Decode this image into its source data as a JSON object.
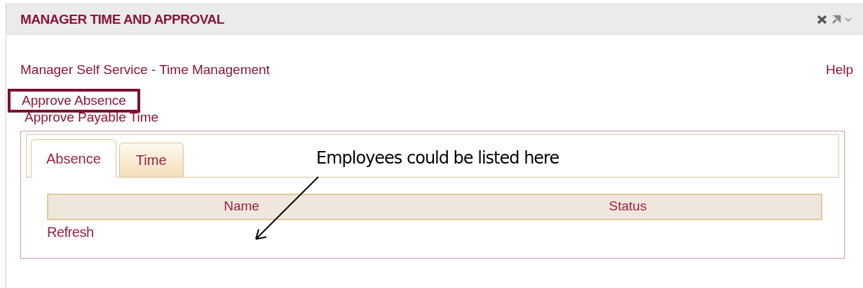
{
  "portlet": {
    "title": "MANAGER TIME AND APPROVAL"
  },
  "page_title": "Manager Self Service - Time Management",
  "help_link": "Help",
  "links": [
    {
      "label": "Approve Absence",
      "highlighted": true
    },
    {
      "label": "Approve Payable Time",
      "highlighted": false
    }
  ],
  "tabs": [
    {
      "label": "Absence",
      "selected": true
    },
    {
      "label": "Time",
      "selected": false
    }
  ],
  "table": {
    "columns": [
      "Name",
      "Status"
    ]
  },
  "refresh_link": "Refresh",
  "annotation": "Employees could be listed here"
}
